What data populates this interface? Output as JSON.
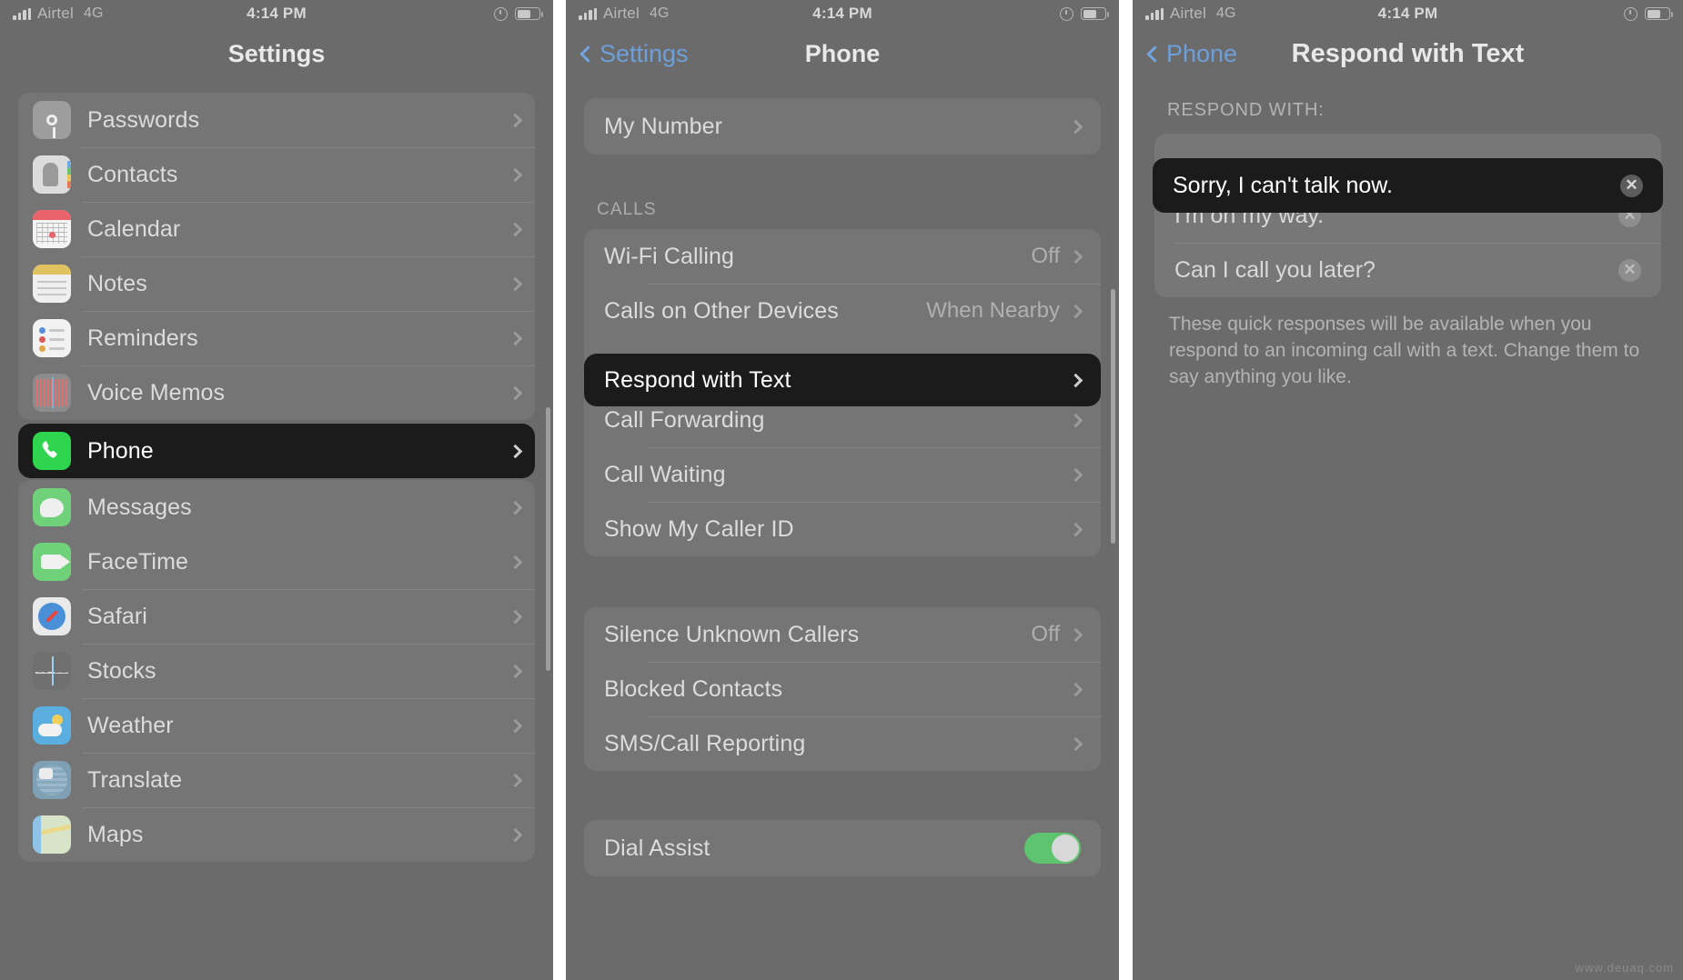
{
  "statusbar": {
    "carrier": "Airtel",
    "network": "4G",
    "time": "4:14 PM",
    "battery_icon": "battery-icon",
    "lock_icon": "rotation-lock-icon",
    "signal_icon": "signal-bars-icon"
  },
  "panel1": {
    "title": "Settings",
    "items": [
      {
        "label": "Passwords",
        "icon": "passwords-icon",
        "selected": false
      },
      {
        "label": "Contacts",
        "icon": "contacts-icon",
        "selected": false
      },
      {
        "label": "Calendar",
        "icon": "calendar-icon",
        "selected": false
      },
      {
        "label": "Notes",
        "icon": "notes-icon",
        "selected": false
      },
      {
        "label": "Reminders",
        "icon": "reminders-icon",
        "selected": false
      },
      {
        "label": "Voice Memos",
        "icon": "voice-memos-icon",
        "selected": false
      },
      {
        "label": "Phone",
        "icon": "phone-icon",
        "selected": true
      },
      {
        "label": "Messages",
        "icon": "messages-icon",
        "selected": false
      },
      {
        "label": "FaceTime",
        "icon": "facetime-icon",
        "selected": false
      },
      {
        "label": "Safari",
        "icon": "safari-icon",
        "selected": false
      },
      {
        "label": "Stocks",
        "icon": "stocks-icon",
        "selected": false
      },
      {
        "label": "Weather",
        "icon": "weather-icon",
        "selected": false
      },
      {
        "label": "Translate",
        "icon": "translate-icon",
        "selected": false
      },
      {
        "label": "Maps",
        "icon": "maps-icon",
        "selected": false
      }
    ]
  },
  "panel2": {
    "back_label": "Settings",
    "title": "Phone",
    "group_my_number": [
      {
        "label": "My Number",
        "value": "",
        "selected": false
      }
    ],
    "section_calls_header": "CALLS",
    "group_calls": [
      {
        "label": "Wi-Fi Calling",
        "value": "Off",
        "selected": false
      },
      {
        "label": "Calls on Other Devices",
        "value": "When Nearby",
        "selected": false
      },
      {
        "label": "Respond with Text",
        "value": "",
        "selected": true
      },
      {
        "label": "Call Forwarding",
        "value": "",
        "selected": false
      },
      {
        "label": "Call Waiting",
        "value": "",
        "selected": false
      },
      {
        "label": "Show My Caller ID",
        "value": "",
        "selected": false
      }
    ],
    "group_blocking": [
      {
        "label": "Silence Unknown Callers",
        "value": "Off",
        "selected": false
      },
      {
        "label": "Blocked Contacts",
        "value": "",
        "selected": false
      },
      {
        "label": "SMS/Call Reporting",
        "value": "",
        "selected": false
      }
    ],
    "group_dial": [
      {
        "label": "Dial Assist",
        "value": "",
        "toggle": true,
        "toggle_on": true
      }
    ]
  },
  "panel3": {
    "back_label": "Phone",
    "title": "Respond with Text",
    "section_header": "RESPOND WITH:",
    "responses": [
      {
        "text": "Sorry, I can't talk now.",
        "selected": true,
        "clear_icon": "clear-circle-icon"
      },
      {
        "text": "I'm on my way.",
        "selected": false,
        "clear_icon": "clear-circle-icon"
      },
      {
        "text": "Can I call you later?",
        "selected": false,
        "clear_icon": "clear-circle-icon"
      }
    ],
    "footer": "These quick responses will be available when you respond to an incoming call with a text. Change them to say anything you like."
  },
  "watermark": "www.deuaq.com",
  "colors": {
    "highlight_bg": "#1b1b1b",
    "accent_blue": "#74a4dd",
    "phone_green": "#2fd44f",
    "toggle_green": "#5fc46f",
    "panel_bg": "#6b6b6b",
    "group_bg": "#757575"
  }
}
